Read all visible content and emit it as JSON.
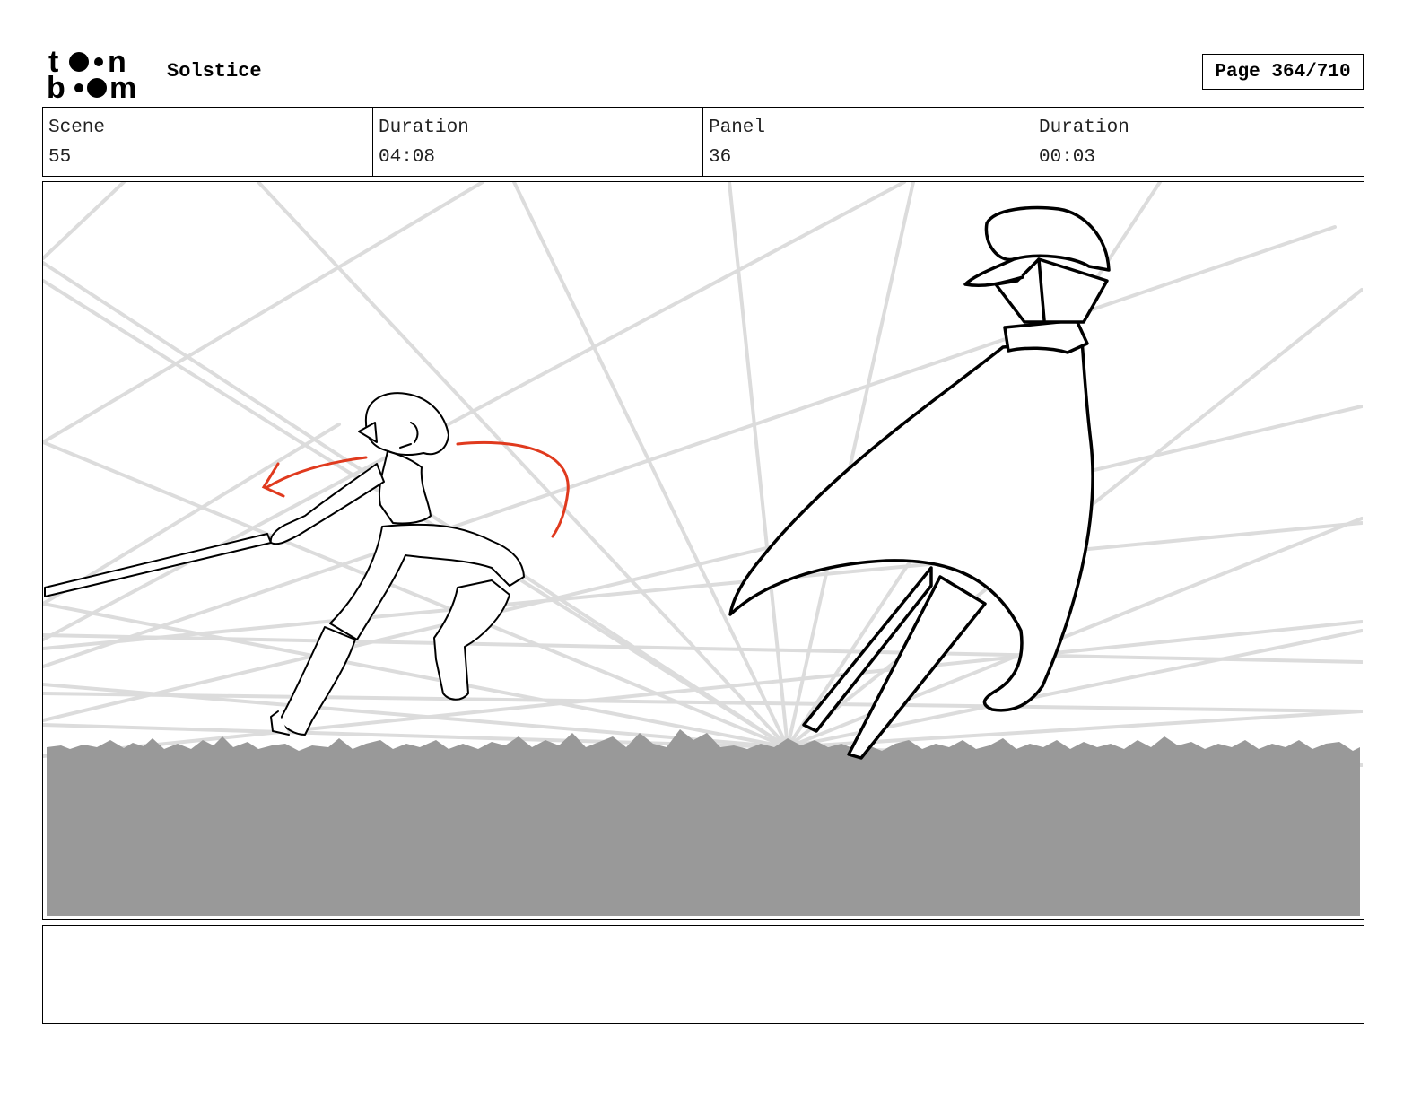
{
  "header": {
    "project_title": "Solstice",
    "page_label": "Page 364/710"
  },
  "info": {
    "scene_label": "Scene",
    "scene_value": "55",
    "scene_duration_label": "Duration",
    "scene_duration_value": "04:08",
    "panel_label": "Panel",
    "panel_value": "36",
    "panel_duration_label": "Duration",
    "panel_duration_value": "00:03"
  },
  "notes": {
    "text": ""
  },
  "colors": {
    "motion_arrow": "#e03a1e",
    "ground": "#999999",
    "speed_lines": "#dcdcdc"
  },
  "icons": {
    "logo": "toon-boom-logo"
  }
}
